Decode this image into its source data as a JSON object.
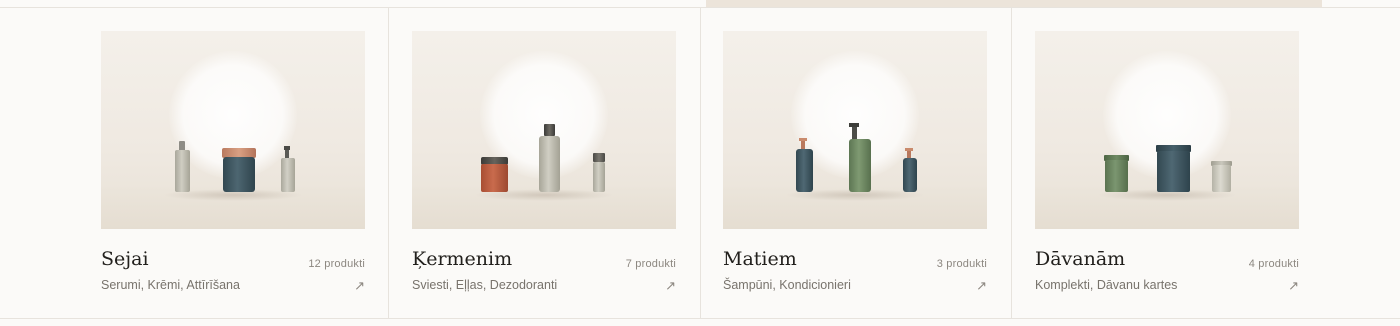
{
  "categories": [
    {
      "title": "Sejai",
      "count": "12 produkti",
      "subtitle": "Serumi, Krēmi, Attīrīšana",
      "arrow": "↗"
    },
    {
      "title": "Ķermenim",
      "count": "7 produkti",
      "subtitle": "Sviesti, Eļļas, Dezodoranti",
      "arrow": "↗"
    },
    {
      "title": "Matiem",
      "count": "3 produkti",
      "subtitle": "Šampūni, Kondicionieri",
      "arrow": "↗"
    },
    {
      "title": "Dāvanām",
      "count": "4 produkti",
      "subtitle": "Komplekti, Dāvanu kartes",
      "arrow": "↗"
    }
  ],
  "colors": {
    "background": "#fbfaf8",
    "accent_band": "#ece4da",
    "divider": "#e7e3dd",
    "bottle_stone": "#b9b7aa",
    "jar_slate": "#3e5560",
    "lid_copper": "#c98a6c",
    "jar_terracotta": "#b7593c",
    "bottle_olive": "#6e8862"
  }
}
